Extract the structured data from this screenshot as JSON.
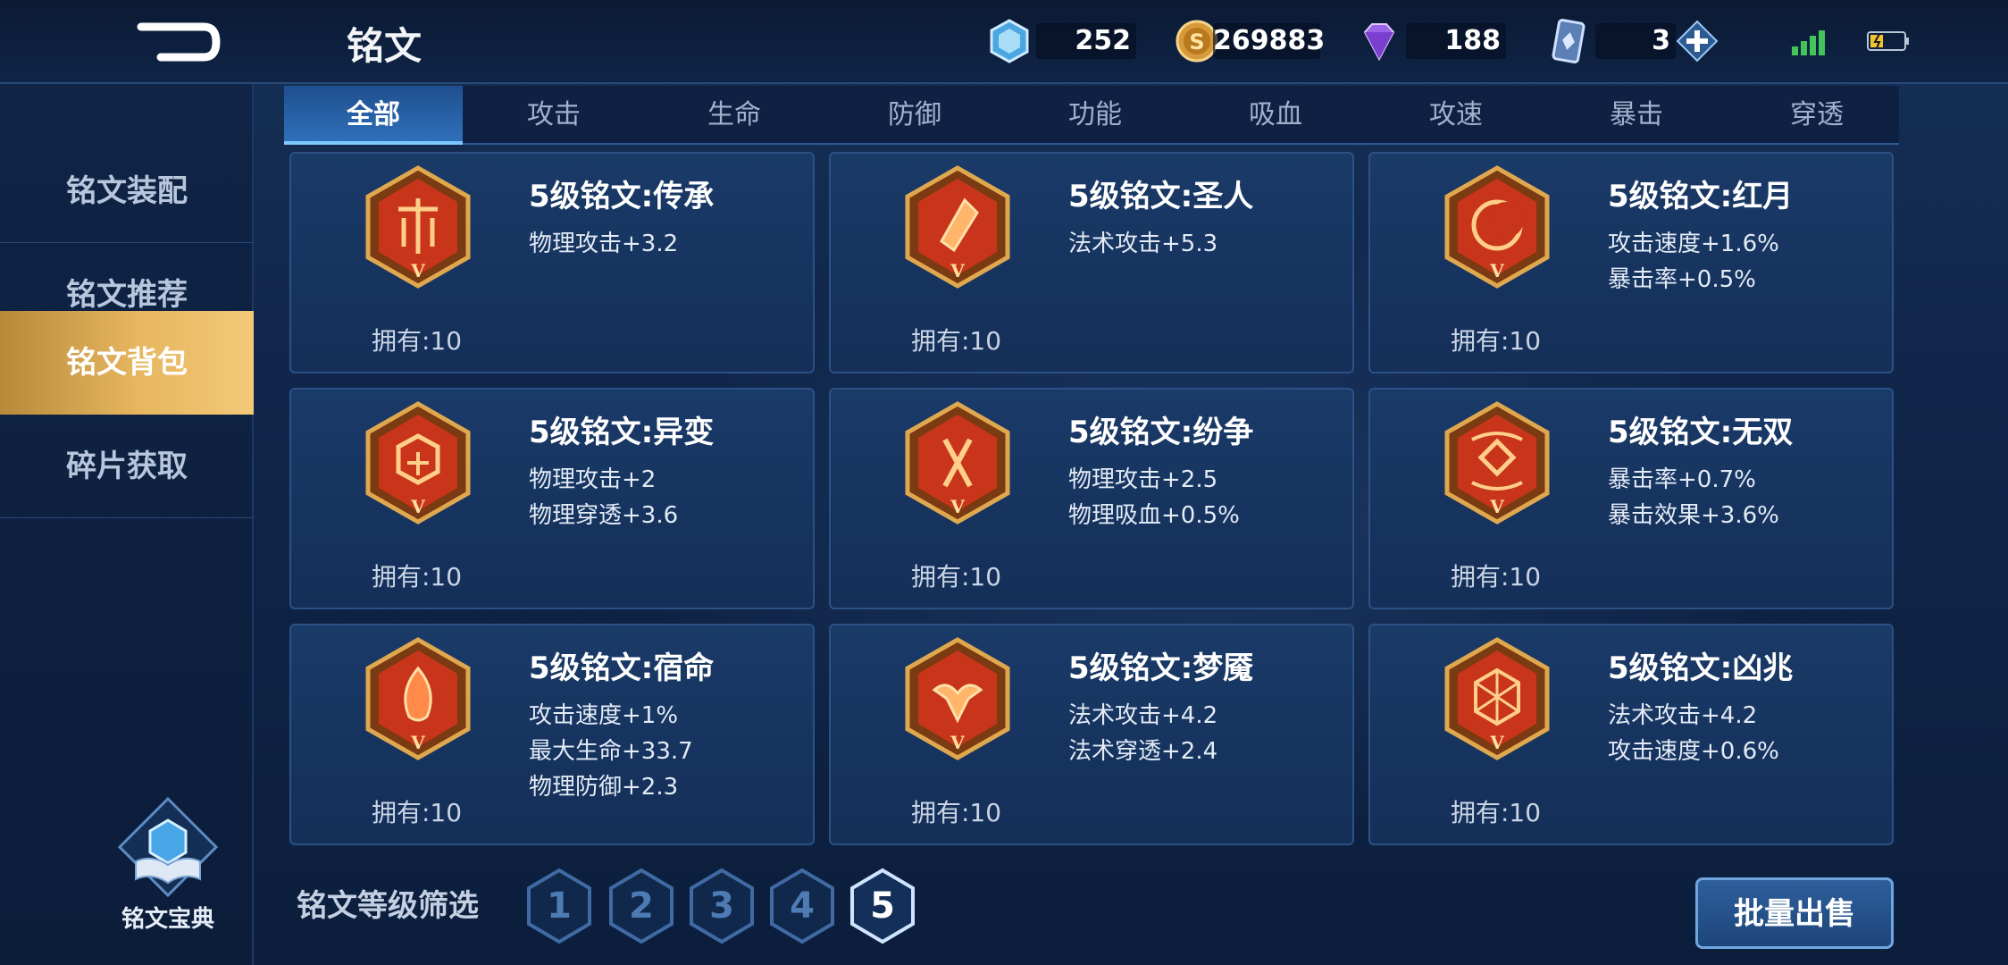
{
  "header": {
    "title": "铭文",
    "back_icon": "back-arrow-icon",
    "currencies": [
      {
        "name": "crystal",
        "icon": "crystal-icon",
        "value": "252"
      },
      {
        "name": "gold",
        "icon": "gold-coin-icon",
        "value": "269883"
      },
      {
        "name": "diamond",
        "icon": "diamond-icon",
        "value": "188"
      },
      {
        "name": "ticket",
        "icon": "card-ticket-icon",
        "value": "3"
      }
    ],
    "add_icon": "plus-icon",
    "signal_icon": "signal-icon",
    "battery_icon": "battery-icon"
  },
  "sidebar": {
    "items": [
      {
        "label": "铭文装配",
        "active": false
      },
      {
        "label": "铭文推荐",
        "active": false
      },
      {
        "label": "铭文背包",
        "active": true
      },
      {
        "label": "碎片获取",
        "active": false
      }
    ],
    "codex_label": "铭文宝典"
  },
  "tabs": [
    "全部",
    "攻击",
    "生命",
    "防御",
    "功能",
    "吸血",
    "攻速",
    "暴击",
    "穿透"
  ],
  "active_tab": "全部",
  "cards": [
    {
      "name": "5级铭文:传承",
      "stats": [
        "物理攻击+3.2"
      ],
      "owned": "拥有:10"
    },
    {
      "name": "5级铭文:圣人",
      "stats": [
        "法术攻击+5.3"
      ],
      "owned": "拥有:10"
    },
    {
      "name": "5级铭文:红月",
      "stats": [
        "攻击速度+1.6%",
        "暴击率+0.5%"
      ],
      "owned": "拥有:10"
    },
    {
      "name": "5级铭文:异变",
      "stats": [
        "物理攻击+2",
        "物理穿透+3.6"
      ],
      "owned": "拥有:10"
    },
    {
      "name": "5级铭文:纷争",
      "stats": [
        "物理攻击+2.5",
        "物理吸血+0.5%"
      ],
      "owned": "拥有:10"
    },
    {
      "name": "5级铭文:无双",
      "stats": [
        "暴击率+0.7%",
        "暴击效果+3.6%"
      ],
      "owned": "拥有:10"
    },
    {
      "name": "5级铭文:宿命",
      "stats": [
        "攻击速度+1%",
        "最大生命+33.7",
        "物理防御+2.3"
      ],
      "owned": "拥有:10"
    },
    {
      "name": "5级铭文:梦魇",
      "stats": [
        "法术攻击+4.2",
        "法术穿透+2.4"
      ],
      "owned": "拥有:10"
    },
    {
      "name": "5级铭文:凶兆",
      "stats": [
        "法术攻击+4.2",
        "攻击速度+0.6%"
      ],
      "owned": "拥有:10"
    }
  ],
  "emblem_numeral": "V",
  "filter": {
    "label": "铭文等级筛选",
    "levels": [
      "1",
      "2",
      "3",
      "4",
      "5"
    ],
    "selected": "5"
  },
  "bulk_sell_label": "批量出售",
  "colors": {
    "accent_gold": "#e7b660",
    "emblem_red": "#c8351a",
    "emblem_border": "#d9a24a",
    "tab_active": "#2f6fba"
  }
}
